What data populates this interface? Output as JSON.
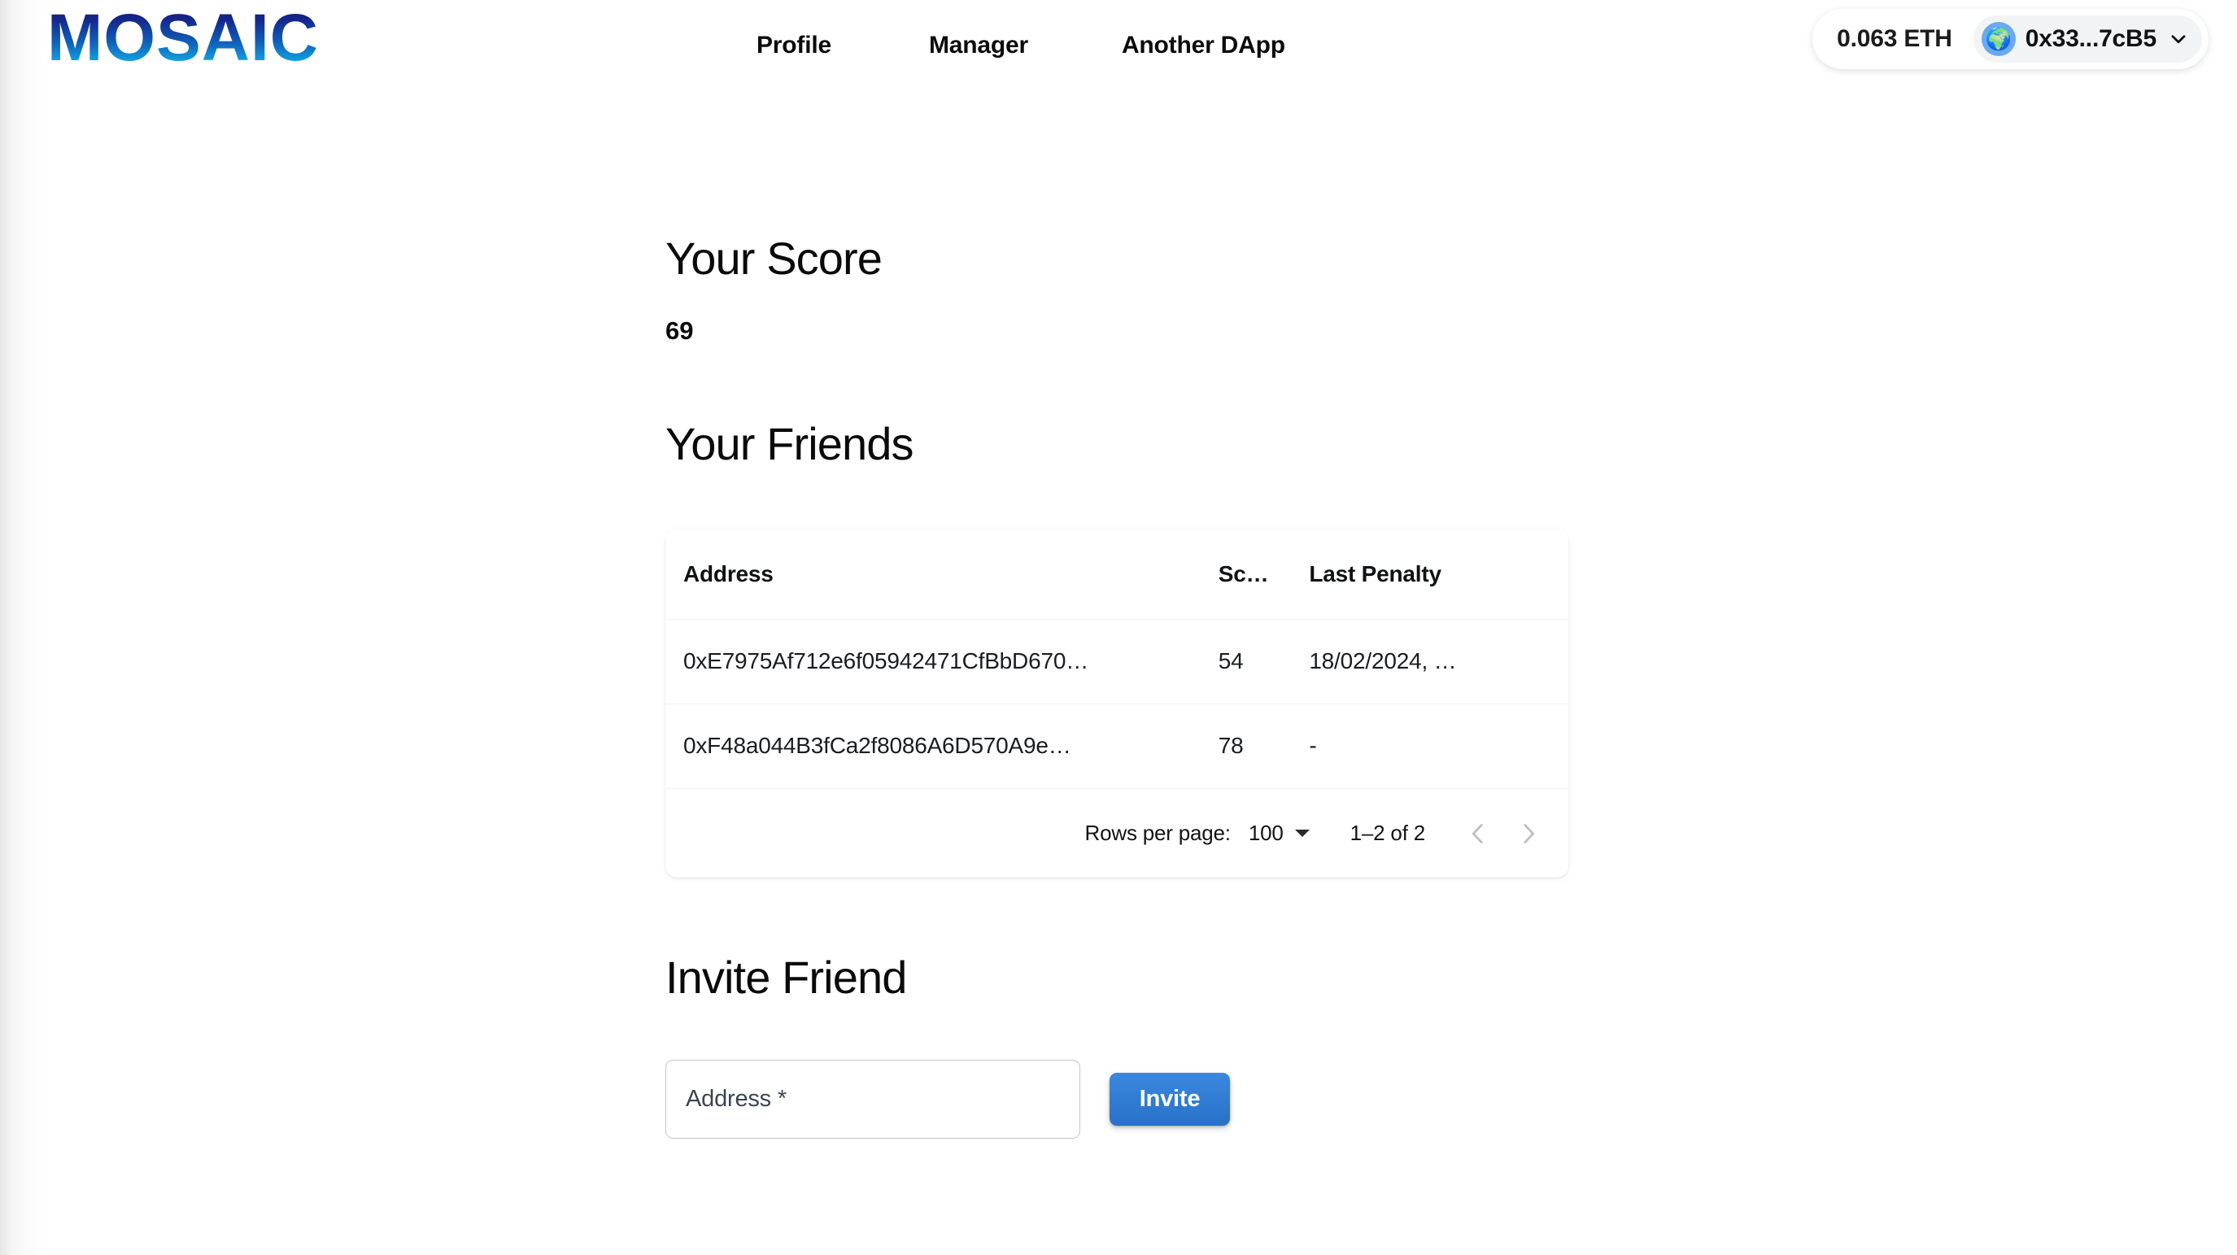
{
  "header": {
    "logo_text": "MOSAIC",
    "nav": [
      {
        "label": "Profile"
      },
      {
        "label": "Manager"
      },
      {
        "label": "Another DApp"
      }
    ],
    "wallet": {
      "balance": "0.063 ETH",
      "address": "0x33...7cB5",
      "avatar_icon": "globe-icon",
      "avatar_glyph": "🌍",
      "chevron_icon": "chevron-down-icon"
    }
  },
  "main": {
    "score_section": {
      "heading": "Your Score",
      "value": "69"
    },
    "friends_section": {
      "heading": "Your Friends",
      "table": {
        "columns": [
          "Address",
          "Sc…",
          "Last Penalty"
        ],
        "rows": [
          {
            "address": "0xE7975Af712e6f05942471CfBbD670…",
            "score": "54",
            "last_penalty": "18/02/2024, …"
          },
          {
            "address": "0xF48a044B3fCa2f8086A6D570A9e…",
            "score": "78",
            "last_penalty": "-"
          }
        ],
        "pagination": {
          "rows_per_page_label": "Rows per page:",
          "rows_per_page_value": "100",
          "range_label": "1–2 of 2",
          "prev_icon": "chevron-left-icon",
          "next_icon": "chevron-right-icon"
        }
      }
    },
    "invite_section": {
      "heading": "Invite Friend",
      "address_placeholder": "Address *",
      "address_value": "",
      "submit_label": "Invite"
    }
  },
  "colors": {
    "logo_gradient_start": "#121c6e",
    "logo_gradient_end": "#27c3f2",
    "invite_button": "#2d79d0",
    "avatar_background": "#69aaf0",
    "text_primary": "#0a0a0a",
    "border_subtle": "#f2f2f3",
    "input_border": "#c3c6cb"
  }
}
